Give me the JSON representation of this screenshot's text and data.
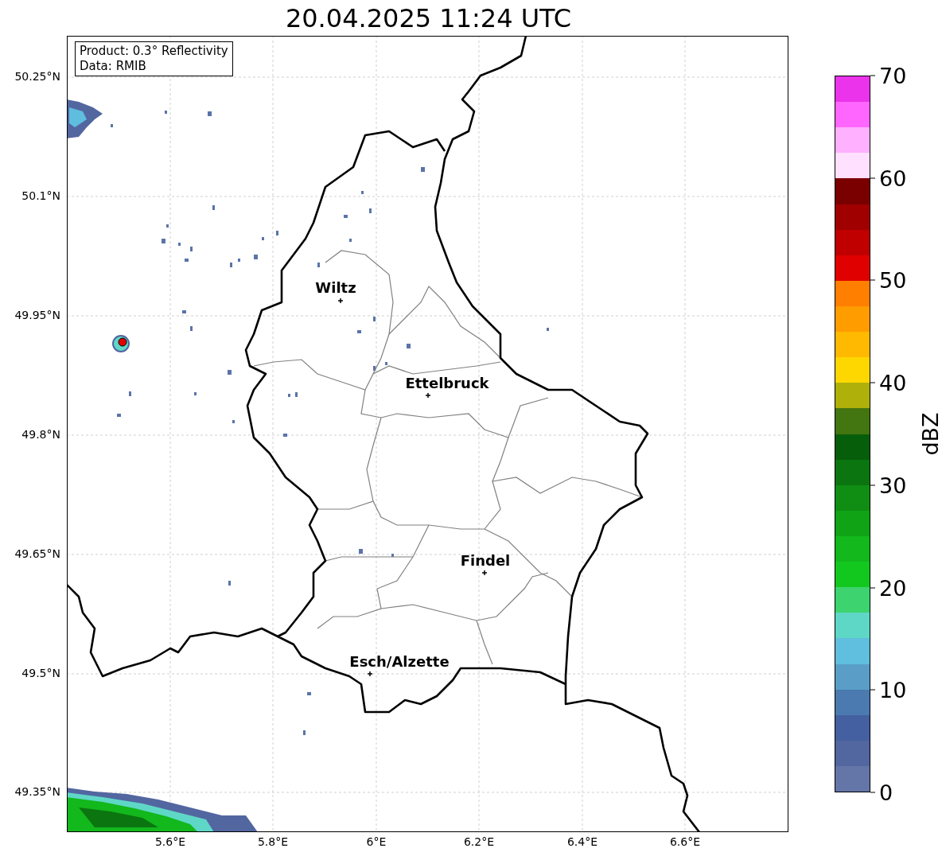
{
  "title": "20.04.2025 11:24 UTC",
  "info_box": {
    "lines": [
      "Product: 0.3° Reflectivity",
      "Data: RMIB"
    ]
  },
  "y_ticks": [
    "50.25°N",
    "50.1°N",
    "49.95°N",
    "49.8°N",
    "49.65°N",
    "49.5°N",
    "49.35°N"
  ],
  "x_ticks": [
    "5.6°E",
    "5.8°E",
    "6°E",
    "6.2°E",
    "6.4°E",
    "6.6°E"
  ],
  "cities": [
    {
      "name": "Wiltz"
    },
    {
      "name": "Ettelbruck"
    },
    {
      "name": "Findel"
    },
    {
      "name": "Esch/Alzette"
    }
  ],
  "colorbar": {
    "label": "dBZ",
    "ticks": [
      "70",
      "60",
      "50",
      "40",
      "30",
      "20",
      "10",
      "0"
    ],
    "bands": [
      {
        "color": "#ea33ea"
      },
      {
        "color": "#ff66ff"
      },
      {
        "color": "#ffb0ff"
      },
      {
        "color": "#ffe0ff"
      },
      {
        "color": "#7a0000"
      },
      {
        "color": "#a00000"
      },
      {
        "color": "#c00000"
      },
      {
        "color": "#e10000"
      },
      {
        "color": "#ff7f00"
      },
      {
        "color": "#ff9c00"
      },
      {
        "color": "#ffb900"
      },
      {
        "color": "#ffd700"
      },
      {
        "color": "#b0b00a"
      },
      {
        "color": "#437510"
      },
      {
        "color": "#075e0a"
      },
      {
        "color": "#0b7510"
      },
      {
        "color": "#0f8e13"
      },
      {
        "color": "#10a316"
      },
      {
        "color": "#12b81c"
      },
      {
        "color": "#12c81f"
      },
      {
        "color": "#3dd36f"
      },
      {
        "color": "#5fd7c7"
      },
      {
        "color": "#60bede"
      },
      {
        "color": "#5a9ec8"
      },
      {
        "color": "#4a7ab0"
      },
      {
        "color": "#4460a0"
      },
      {
        "color": "#5266a0"
      },
      {
        "color": "#6475a8"
      }
    ]
  }
}
